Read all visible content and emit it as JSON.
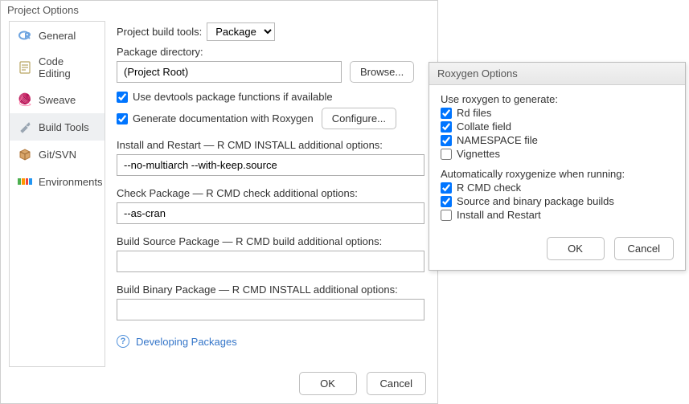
{
  "dialog": {
    "title": "Project Options"
  },
  "sidebar": {
    "items": [
      {
        "label": "General"
      },
      {
        "label": "Code Editing"
      },
      {
        "label": "Sweave"
      },
      {
        "label": "Build Tools"
      },
      {
        "label": "Git/SVN"
      },
      {
        "label": "Environments"
      }
    ]
  },
  "content": {
    "build_tools_label": "Project build tools:",
    "build_tools_value": "Package",
    "pkg_dir_label": "Package directory:",
    "pkg_dir_value": "(Project Root)",
    "browse_label": "Browse...",
    "use_devtools": {
      "checked": true,
      "label": "Use devtools package functions if available"
    },
    "gen_roxygen": {
      "checked": true,
      "label": "Generate documentation with Roxygen"
    },
    "configure_label": "Configure...",
    "install_restart_label": "Install and Restart — R CMD INSTALL additional options:",
    "install_restart_value": "--no-multiarch --with-keep.source",
    "check_label": "Check Package — R CMD check additional options:",
    "check_value": "--as-cran",
    "build_src_label": "Build Source Package — R CMD build additional options:",
    "build_src_value": "",
    "build_bin_label": "Build Binary Package — R CMD INSTALL additional options:",
    "build_bin_value": "",
    "help_link": "Developing Packages"
  },
  "footer": {
    "ok": "OK",
    "cancel": "Cancel"
  },
  "roxygen": {
    "title": "Roxygen Options",
    "gen_heading": "Use roxygen to generate:",
    "gen": [
      {
        "checked": true,
        "label": "Rd files"
      },
      {
        "checked": true,
        "label": "Collate field"
      },
      {
        "checked": true,
        "label": "NAMESPACE file"
      },
      {
        "checked": false,
        "label": "Vignettes"
      }
    ],
    "auto_heading": "Automatically roxygenize when running:",
    "auto": [
      {
        "checked": true,
        "label": "R CMD check"
      },
      {
        "checked": true,
        "label": "Source and binary package builds"
      },
      {
        "checked": false,
        "label": "Install and Restart"
      }
    ],
    "ok": "OK",
    "cancel": "Cancel"
  }
}
